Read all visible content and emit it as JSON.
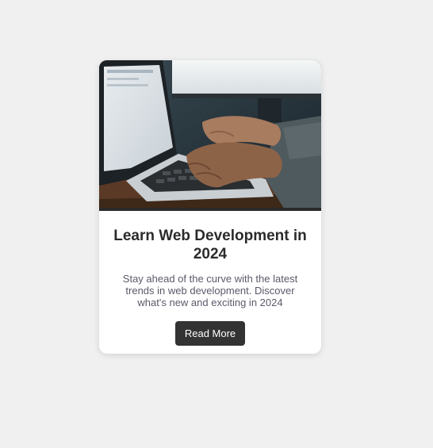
{
  "card": {
    "image": {
      "icon": "laptop-typing-photo"
    },
    "title": "Learn Web Development in 2024",
    "description": "Stay ahead of the curve with the latest trends in web development. Discover what's new and exciting in 2024",
    "button_label": "Read More"
  },
  "colors": {
    "page_background": "#f0f0f0",
    "card_background": "#ffffff",
    "button_background": "#333333",
    "button_text": "#ffffff",
    "title_text": "#2b2b2b",
    "body_text": "#5a5a6a"
  }
}
